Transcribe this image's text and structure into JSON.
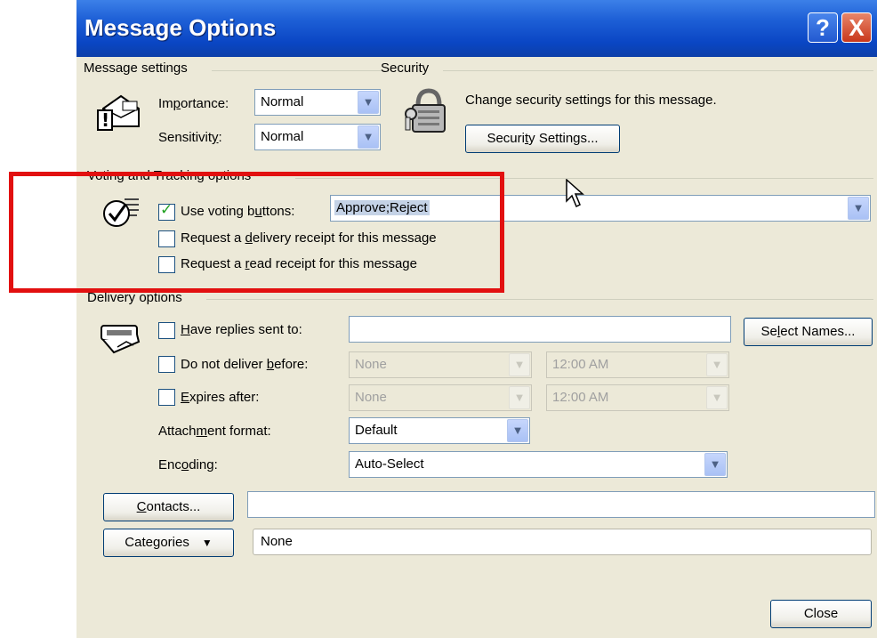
{
  "window": {
    "title": "Message Options",
    "help_btn": "?",
    "close_btn": "X"
  },
  "message_settings": {
    "header": "Message settings",
    "importance_label_pre": "Im",
    "importance_label_u": "p",
    "importance_label_post": "ortance:",
    "importance_value": "Normal",
    "sensitivity_label_pre": "Sensitivit",
    "sensitivity_label_u": "y",
    "sensitivity_label_post": ":",
    "sensitivity_value": "Normal"
  },
  "security": {
    "header": "Security",
    "description": "Change security settings for this message.",
    "button_pre": "Securi",
    "button_u": "t",
    "button_post": "y Settings..."
  },
  "voting": {
    "header": "Voting and Tracking options",
    "use_voting_pre": "Use voting b",
    "use_voting_u": "u",
    "use_voting_post": "ttons:",
    "use_voting_checked": true,
    "voting_value": "Approve;Reject",
    "delivery_receipt_pre": "Request a ",
    "delivery_receipt_u": "d",
    "delivery_receipt_post": "elivery receipt for this message",
    "read_receipt_pre": "Request a ",
    "read_receipt_u": "r",
    "read_receipt_post": "ead receipt for this message"
  },
  "delivery": {
    "header": "Delivery options",
    "replies_pre": "",
    "replies_u": "H",
    "replies_post": "ave replies sent to:",
    "replies_value": "",
    "select_names_pre": "Se",
    "select_names_u": "l",
    "select_names_post": "ect Names...",
    "not_before_pre": "Do not deliver ",
    "not_before_u": "b",
    "not_before_post": "efore:",
    "not_before_date": "None",
    "not_before_time": "12:00 AM",
    "expires_pre": "",
    "expires_u": "E",
    "expires_post": "xpires after:",
    "expires_date": "None",
    "expires_time": "12:00 AM",
    "attachment_pre": "Attach",
    "attachment_u": "m",
    "attachment_post": "ent format:",
    "attachment_value": "Default",
    "encoding_pre": "Enc",
    "encoding_u": "o",
    "encoding_post": "ding:",
    "encoding_value": "Auto-Select"
  },
  "contacts": {
    "button_pre": "",
    "button_u": "C",
    "button_post": "ontacts...",
    "value": ""
  },
  "categories": {
    "button_pre": "Cate",
    "button_u": "g",
    "button_post": "ories",
    "value": "None"
  },
  "footer": {
    "close_label": "Close"
  },
  "colors": {
    "title_bar": "#0a46c4",
    "dialog_bg": "#ece9d8",
    "annotation_box": "#e21010",
    "check_mark": "#21a121"
  }
}
